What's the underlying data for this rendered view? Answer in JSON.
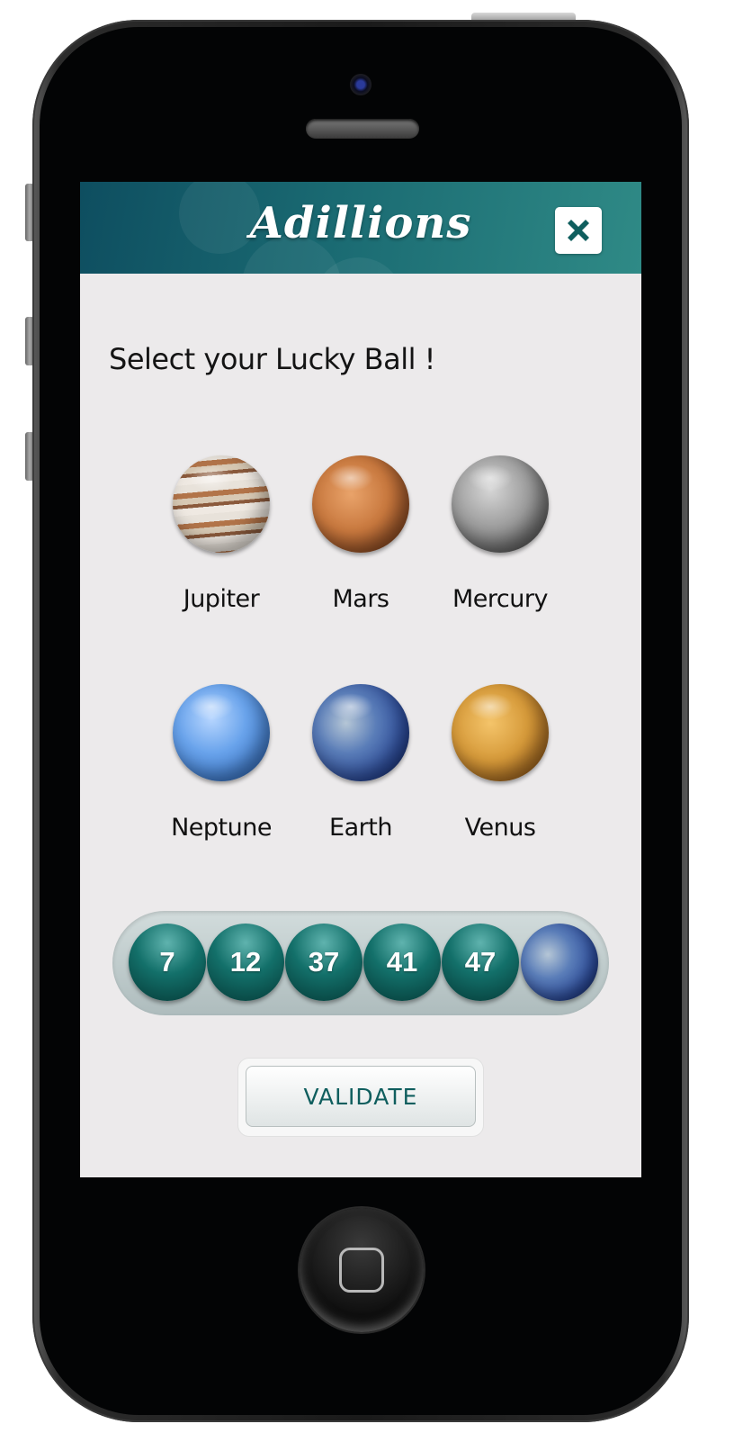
{
  "app": {
    "title": "Adillions"
  },
  "header": {
    "close_icon": "close-icon"
  },
  "prompt": "Select your Lucky Ball !",
  "planets": [
    {
      "label": "Jupiter",
      "icon": "jupiter-planet-icon"
    },
    {
      "label": "Mars",
      "icon": "mars-planet-icon"
    },
    {
      "label": "Mercury",
      "icon": "mercury-planet-icon"
    },
    {
      "label": "Neptune",
      "icon": "neptune-planet-icon"
    },
    {
      "label": "Earth",
      "icon": "earth-planet-icon"
    },
    {
      "label": "Venus",
      "icon": "venus-planet-icon"
    }
  ],
  "selection": {
    "numbers": [
      "7",
      "12",
      "37",
      "41",
      "47"
    ],
    "lucky_ball_icon": "earth-planet-icon"
  },
  "validate_label": "VALIDATE",
  "colors": {
    "accent": "#0f5e5e",
    "header": "#1a6a72",
    "background": "#eceaeb"
  }
}
